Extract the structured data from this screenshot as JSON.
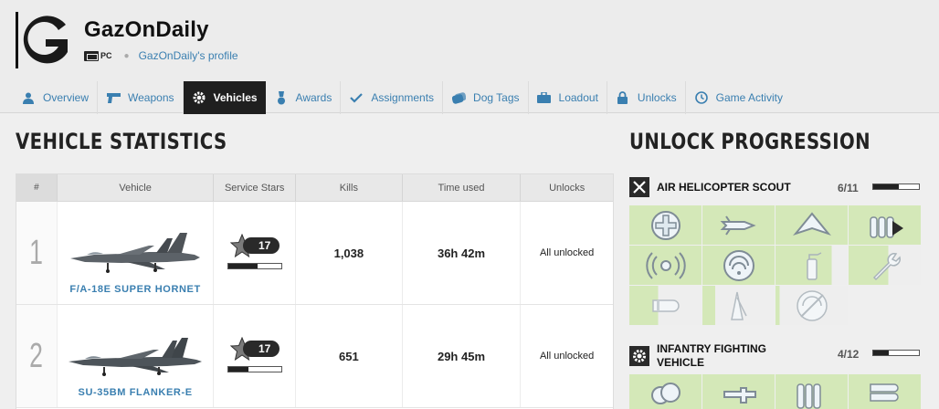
{
  "profile": {
    "username": "GazOnDaily",
    "platform": "PC",
    "profile_link": "GazOnDaily's profile"
  },
  "nav": {
    "tabs": [
      {
        "label": "Overview",
        "icon": "person-icon",
        "active": false
      },
      {
        "label": "Weapons",
        "icon": "pistol-icon",
        "active": false
      },
      {
        "label": "Vehicles",
        "icon": "gear-icon",
        "active": true
      },
      {
        "label": "Awards",
        "icon": "medal-icon",
        "active": false
      },
      {
        "label": "Assignments",
        "icon": "checkmark-icon",
        "active": false
      },
      {
        "label": "Dog Tags",
        "icon": "dog-tag-icon",
        "active": false
      },
      {
        "label": "Loadout",
        "icon": "briefcase-icon",
        "active": false
      },
      {
        "label": "Unlocks",
        "icon": "lock-icon",
        "active": false
      },
      {
        "label": "Game Activity",
        "icon": "clock-icon",
        "active": false
      }
    ]
  },
  "vehicle_stats": {
    "title": "VEHICLE STATISTICS",
    "columns": [
      "#",
      "Vehicle",
      "Service Stars",
      "Kills",
      "Time used",
      "Unlocks"
    ],
    "rows": [
      {
        "rank": "1",
        "vehicle": "F/A-18E SUPER HORNET",
        "stars": "17",
        "star_progress": 0.55,
        "kills": "1,038",
        "time": "36h 42m",
        "unlocks": "All unlocked"
      },
      {
        "rank": "2",
        "vehicle": "SU-35BM FLANKER-E",
        "stars": "17",
        "star_progress": 0.38,
        "kills": "651",
        "time": "29h 45m",
        "unlocks": "All unlocked"
      }
    ]
  },
  "unlock_progression": {
    "title": "UNLOCK PROGRESSION",
    "groups": [
      {
        "label": "AIR HELICOPTER SCOUT",
        "count": "6/11",
        "progress": 0.55,
        "icon": "crossed-out-icon"
      },
      {
        "label_line1": "INFANTRY FIGHTING",
        "label_line2": "VEHICLE",
        "count": "4/12",
        "progress": 0.33,
        "icon": "gear-icon"
      }
    ]
  },
  "colors": {
    "accent": "#3a7fb0",
    "unlocked": "#d4e8b8",
    "active_tab": "#1f1f1f"
  }
}
